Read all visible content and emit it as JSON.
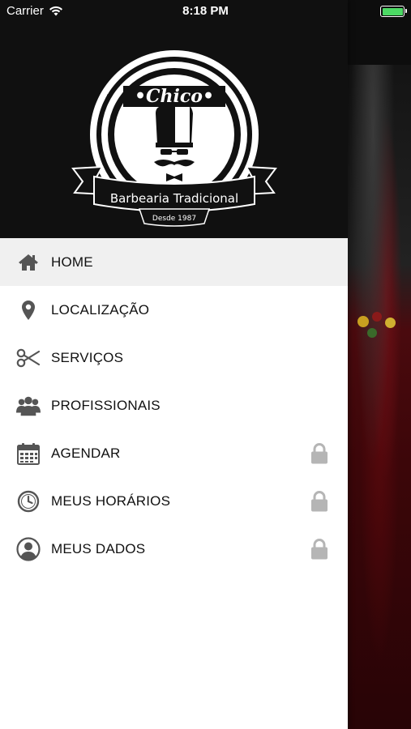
{
  "status_bar": {
    "carrier": "Carrier",
    "time": "8:18 PM",
    "battery_percent": 100
  },
  "logo": {
    "name": "Chico",
    "tagline": "Barbearia Tradicional",
    "since": "Desde 1987"
  },
  "menu": {
    "items": [
      {
        "label": "HOME",
        "icon": "home-icon",
        "active": true,
        "locked": false
      },
      {
        "label": "LOCALIZAÇÃO",
        "icon": "location-pin-icon",
        "active": false,
        "locked": false
      },
      {
        "label": "SERVIÇOS",
        "icon": "scissors-icon",
        "active": false,
        "locked": false
      },
      {
        "label": "PROFISSIONAIS",
        "icon": "users-icon",
        "active": false,
        "locked": false
      },
      {
        "label": "AGENDAR",
        "icon": "calendar-icon",
        "active": false,
        "locked": true
      },
      {
        "label": "MEUS HORÁRIOS",
        "icon": "clock-icon",
        "active": false,
        "locked": true
      },
      {
        "label": "MEUS DADOS",
        "icon": "user-circle-icon",
        "active": false,
        "locked": true
      }
    ]
  },
  "colors": {
    "icon": "#555555",
    "lock": "#b5b5b5",
    "active_bg": "#f0f0f0",
    "header_bg": "#101010",
    "battery": "#4cd964"
  }
}
